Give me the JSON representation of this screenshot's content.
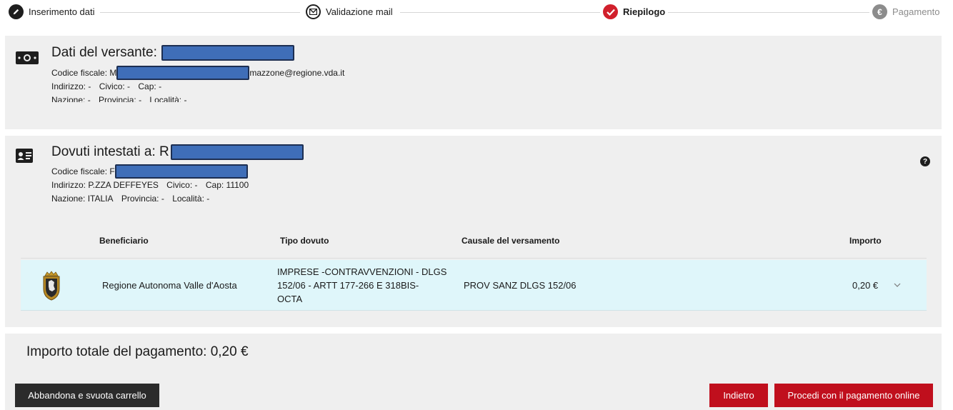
{
  "stepper": {
    "steps": [
      {
        "label": "Inserimento dati",
        "icon": "pencil-icon",
        "state": "done"
      },
      {
        "label": "Validazione mail",
        "icon": "envelope-icon",
        "state": "done"
      },
      {
        "label": "Riepilogo",
        "icon": "check-icon",
        "state": "active"
      },
      {
        "label": "Pagamento",
        "icon": "euro-icon",
        "state": "disabled"
      }
    ]
  },
  "versante": {
    "title": "Dati del versante:",
    "codice_fiscale_label": "Codice fiscale: M",
    "email_suffix": "mazzone@regione.vda.it",
    "indirizzo": "Indirizzo: -",
    "civico": "Civico: -",
    "cap": "Cap: -",
    "nazione": "Nazione: -",
    "provincia": "Provincia: -",
    "localita": "Località: -"
  },
  "dovuti": {
    "title": "Dovuti intestati a: R",
    "codice_fiscale_label": "Codice fiscale: F",
    "indirizzo": "Indirizzo: P.ZZA DEFFEYES",
    "civico": "Civico: -",
    "cap": "Cap: 11100",
    "nazione": "Nazione: ITALIA",
    "provincia": "Provincia: -",
    "localita": "Località: -",
    "help": "?",
    "table": {
      "headers": {
        "beneficiario": "Beneficiario",
        "tipo_dovuto": "Tipo dovuto",
        "causale": "Causale del versamento",
        "importo": "Importo"
      },
      "rows": [
        {
          "beneficiario": "Regione Autonoma Valle d'Aosta",
          "tipo_dovuto_line1": "IMPRESE -CONTRAVVENZIONI - DLGS",
          "tipo_dovuto_line2": "152/06 - ARTT 177-266 E 318BIS-",
          "tipo_dovuto_line3": "OCTA",
          "causale": "PROV SANZ DLGS 152/06",
          "importo": "0,20 €"
        }
      ]
    }
  },
  "totale": {
    "title": "Importo totale del pagamento: 0,20 €"
  },
  "buttons": {
    "abbandona": "Abbandona e svuota carrello",
    "indietro": "Indietro",
    "procedi": "Procedi con il pagamento online"
  },
  "colors": {
    "accent_red": "#c00f1d",
    "row_highlight": "#dff6fa",
    "panel_bg": "#efefef",
    "redaction": "#3f6eb8"
  }
}
